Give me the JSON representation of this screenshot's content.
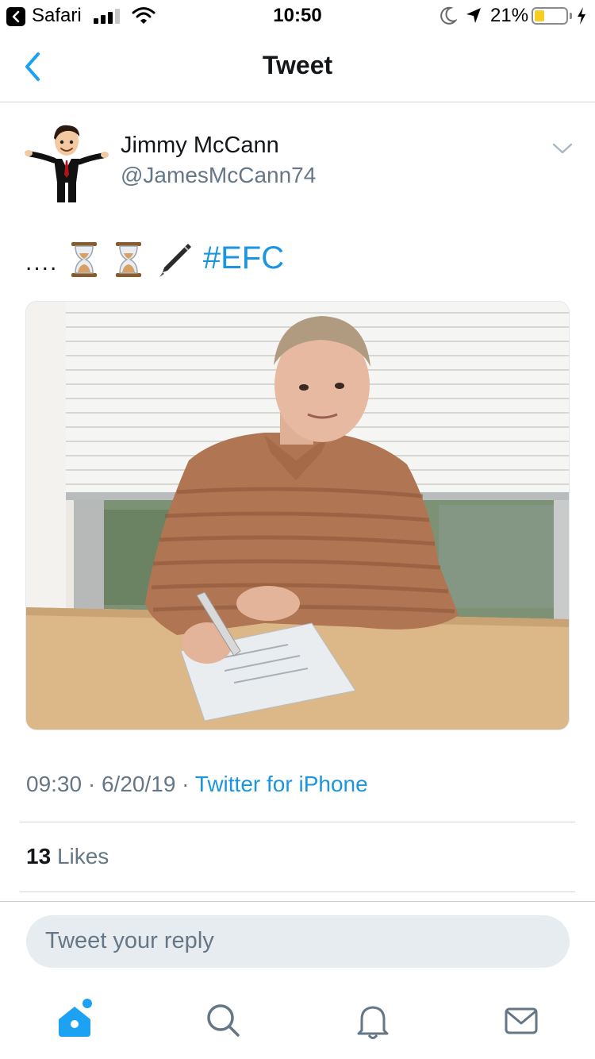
{
  "status_bar": {
    "back_app": "Safari",
    "time": "10:50",
    "battery": "21%",
    "icons": [
      "back-arrow-icon",
      "signal-icon",
      "wifi-icon",
      "moon-icon",
      "location-icon",
      "battery-icon",
      "charging-icon"
    ]
  },
  "nav": {
    "title": "Tweet",
    "back_icon": "chevron-left-icon"
  },
  "tweet": {
    "author_name": "Jimmy McCann",
    "author_handle": "@JamesMcCann74",
    "text_prefix": "....",
    "emojis": [
      "hourglass-icon",
      "hourglass-icon",
      "pen-icon"
    ],
    "hashtag": "#EFC",
    "time": "09:30",
    "date": "6/20/19",
    "separator": "·",
    "source": "Twitter for iPhone",
    "likes_count": "13",
    "likes_label": "Likes"
  },
  "reply": {
    "placeholder": "Tweet your reply"
  },
  "tabs": [
    "home-icon",
    "search-icon",
    "notifications-icon",
    "messages-icon"
  ],
  "colors": {
    "accent": "#1da1f2",
    "link": "#1b95e0",
    "secondary_text": "#657786",
    "reply_bg": "#e6ecf0"
  }
}
